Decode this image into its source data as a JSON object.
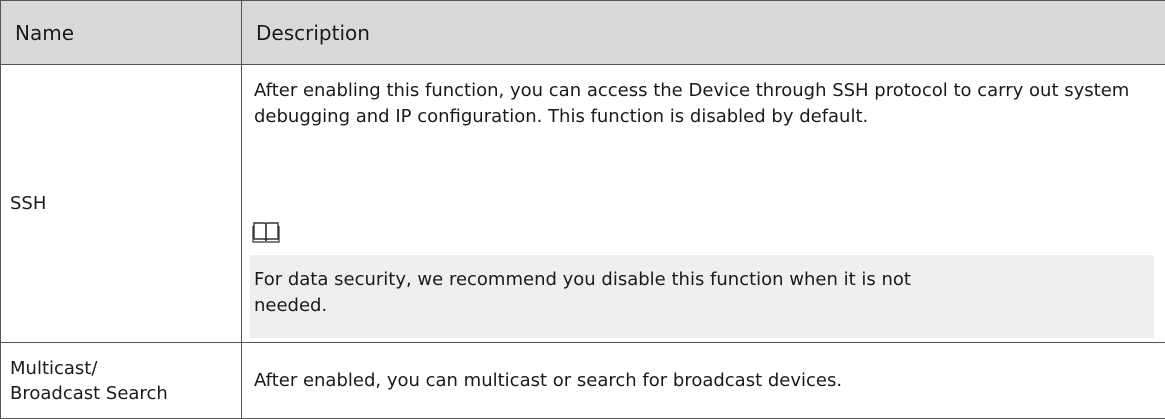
{
  "table": {
    "headers": {
      "name": "Name",
      "description": "Description"
    },
    "rows": [
      {
        "name": "SSH",
        "description": "After enabling this function, you can access the Device through SSH protocol to carry out system debugging and IP configuration. This function is disabled by default.",
        "note_icon": "book-note-icon",
        "note": "For data security, we recommend you disable this function when it is not needed."
      },
      {
        "name_line1": "Multicast/",
        "name_line2": "Broadcast Search",
        "description": "After enabled, you can multicast or search for broadcast devices."
      }
    ]
  }
}
